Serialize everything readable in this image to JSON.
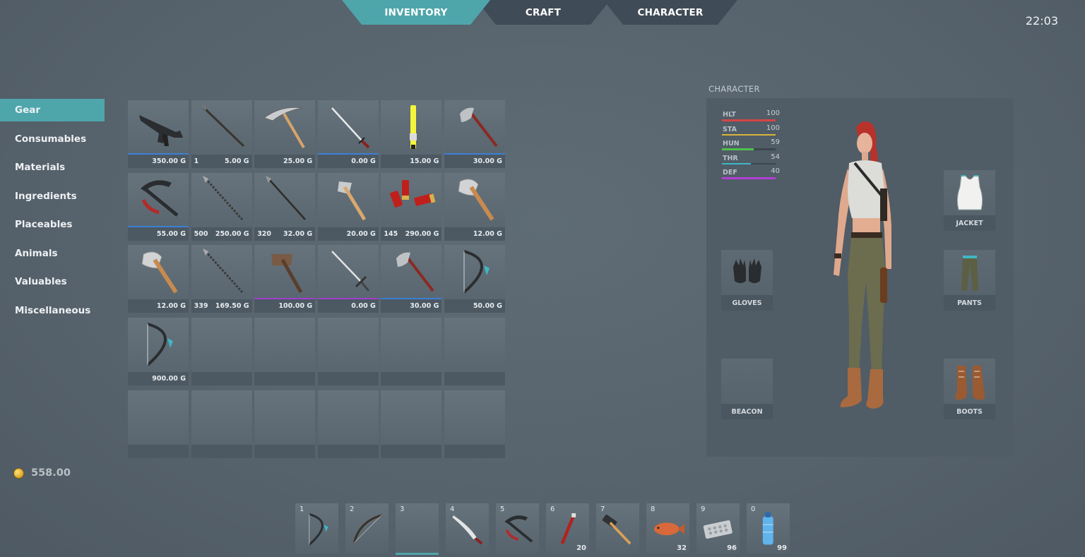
{
  "tabs": [
    {
      "label": "INVENTORY",
      "active": true
    },
    {
      "label": "CRAFT",
      "active": false
    },
    {
      "label": "CHARACTER",
      "active": false
    }
  ],
  "clock": "22:03",
  "sidebar": {
    "items": [
      {
        "label": "Gear",
        "active": true
      },
      {
        "label": "Consumables"
      },
      {
        "label": "Materials"
      },
      {
        "label": "Ingredients"
      },
      {
        "label": "Placeables"
      },
      {
        "label": "Animals"
      },
      {
        "label": "Valuables"
      },
      {
        "label": "Miscellaneous"
      }
    ]
  },
  "gold": {
    "value": "558.00",
    "icon": "coin-icon"
  },
  "colors": {
    "accent": "#4ea6ab",
    "rare": "#3b7fd6",
    "epic": "#a23fd1"
  },
  "inventory": {
    "slots": [
      {
        "icon": "assault-rifle-icon",
        "qty": "",
        "price": "350.00 G",
        "rarity": "#3b7fd6"
      },
      {
        "icon": "spear-icon",
        "qty": "1",
        "price": "5.00 G",
        "rarity": ""
      },
      {
        "icon": "pickaxe-icon",
        "qty": "",
        "price": "25.00 G",
        "rarity": ""
      },
      {
        "icon": "katana-icon",
        "qty": "",
        "price": "0.00 G",
        "rarity": "#3b7fd6"
      },
      {
        "icon": "glowstick-icon",
        "qty": "",
        "price": "15.00 G",
        "rarity": ""
      },
      {
        "icon": "tomahawk-icon",
        "qty": "",
        "price": "30.00 G",
        "rarity": "#3b7fd6"
      },
      {
        "icon": "crossbow-icon",
        "qty": "",
        "price": "55.00 G",
        "rarity": "#3b7fd6"
      },
      {
        "icon": "arrow-bundle-icon",
        "qty": "500",
        "price": "250.00 G",
        "rarity": ""
      },
      {
        "icon": "arrow-icon",
        "qty": "320",
        "price": "32.00 G",
        "rarity": ""
      },
      {
        "icon": "hatchet-icon",
        "qty": "",
        "price": "20.00 G",
        "rarity": ""
      },
      {
        "icon": "shotgun-shells-icon",
        "qty": "145",
        "price": "290.00 G",
        "rarity": ""
      },
      {
        "icon": "axe-icon",
        "qty": "",
        "price": "12.00 G",
        "rarity": ""
      },
      {
        "icon": "axe-icon",
        "qty": "",
        "price": "12.00 G",
        "rarity": ""
      },
      {
        "icon": "arrow-bundle-icon",
        "qty": "339",
        "price": "169.50 G",
        "rarity": ""
      },
      {
        "icon": "war-hammer-icon",
        "qty": "",
        "price": "100.00 G",
        "rarity": "#a23fd1"
      },
      {
        "icon": "longsword-icon",
        "qty": "",
        "price": "0.00 G",
        "rarity": "#a23fd1"
      },
      {
        "icon": "tomahawk-icon",
        "qty": "",
        "price": "30.00 G",
        "rarity": "#3b7fd6"
      },
      {
        "icon": "compound-bow-icon",
        "qty": "",
        "price": "50.00 G",
        "rarity": ""
      },
      {
        "icon": "compound-bow-icon",
        "qty": "",
        "price": "900.00 G",
        "rarity": ""
      },
      {
        "icon": "",
        "qty": "",
        "price": "",
        "rarity": ""
      },
      {
        "icon": "",
        "qty": "",
        "price": "",
        "rarity": ""
      },
      {
        "icon": "",
        "qty": "",
        "price": "",
        "rarity": ""
      },
      {
        "icon": "",
        "qty": "",
        "price": "",
        "rarity": ""
      },
      {
        "icon": "",
        "qty": "",
        "price": "",
        "rarity": ""
      },
      {
        "icon": "",
        "qty": "",
        "price": "",
        "rarity": ""
      },
      {
        "icon": "",
        "qty": "",
        "price": "",
        "rarity": ""
      },
      {
        "icon": "",
        "qty": "",
        "price": "",
        "rarity": ""
      },
      {
        "icon": "",
        "qty": "",
        "price": "",
        "rarity": ""
      },
      {
        "icon": "",
        "qty": "",
        "price": "",
        "rarity": ""
      },
      {
        "icon": "",
        "qty": "",
        "price": "",
        "rarity": ""
      }
    ]
  },
  "character": {
    "title": "CHARACTER",
    "stats": [
      {
        "label": "HLT",
        "value": "100",
        "color": "#d64545",
        "fraction": 1.0
      },
      {
        "label": "STA",
        "value": "100",
        "color": "#d9b43a",
        "fraction": 1.0
      },
      {
        "label": "HUN",
        "value": "59",
        "color": "#4fc24a",
        "fraction": 0.59
      },
      {
        "label": "THR",
        "value": "54",
        "color": "#3fb7c6",
        "fraction": 0.54
      },
      {
        "label": "DEF",
        "value": "40",
        "color": "#b23fd6",
        "fraction": 1.0
      }
    ],
    "equipment": {
      "jacket": {
        "label": "JACKET",
        "icon": "tank-top-icon"
      },
      "gloves": {
        "label": "GLOVES",
        "icon": "gloves-icon"
      },
      "pants": {
        "label": "PANTS",
        "icon": "pants-icon"
      },
      "beacon": {
        "label": "BEACON",
        "icon": ""
      },
      "boots": {
        "label": "BOOTS",
        "icon": "boots-icon"
      }
    }
  },
  "hotbar": [
    {
      "key": "1",
      "icon": "compound-bow-icon",
      "count": ""
    },
    {
      "key": "2",
      "icon": "recurve-bow-icon",
      "count": ""
    },
    {
      "key": "3",
      "icon": "",
      "count": "",
      "selected": true
    },
    {
      "key": "4",
      "icon": "machete-icon",
      "count": ""
    },
    {
      "key": "5",
      "icon": "crossbow-icon",
      "count": ""
    },
    {
      "key": "6",
      "icon": "flare-icon",
      "count": "20"
    },
    {
      "key": "7",
      "icon": "sledgehammer-icon",
      "count": ""
    },
    {
      "key": "8",
      "icon": "fish-icon",
      "count": "32"
    },
    {
      "key": "9",
      "icon": "pills-icon",
      "count": "96"
    },
    {
      "key": "0",
      "icon": "water-bottle-icon",
      "count": "99"
    }
  ]
}
